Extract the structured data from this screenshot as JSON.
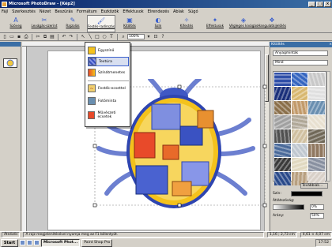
{
  "window": {
    "title": "Microsoft PhotoDraw - [Kép2]"
  },
  "menu": [
    "Fájl",
    "Szerkesztés",
    "Nézet",
    "Beszúrás",
    "Formátum",
    "Eszközök",
    "Effektusok",
    "Elrendezés",
    "Ablak",
    "Súgó"
  ],
  "big_toolbar": [
    {
      "label": "Szöveg",
      "icon": "text-icon"
    },
    {
      "label": "Levágás-szerint",
      "icon": "crop-icon"
    },
    {
      "label": "Rajzolás",
      "icon": "draw-icon"
    },
    {
      "label": "Festés-radírozás",
      "icon": "paint-icon"
    },
    {
      "label": "Kitöltés",
      "icon": "fill-icon"
    },
    {
      "label": "Szín",
      "icon": "color-icon"
    },
    {
      "label": "Kifestés",
      "icon": "touch-up-icon"
    },
    {
      "label": "Effektusok",
      "icon": "effects-icon"
    },
    {
      "label": "Végleges kivágás",
      "icon": "cutout-icon"
    },
    {
      "label": "Hangulatkijelölés",
      "icon": "designer-icon"
    }
  ],
  "zoom": "100%",
  "dropdown": {
    "items": [
      {
        "label": "Egyszínű",
        "icon": "solid-fill-icon",
        "selected": false
      },
      {
        "label": "Textúra",
        "icon": "texture-icon",
        "selected": true
      },
      {
        "label": "Színátmenetes",
        "icon": "gradient-icon",
        "selected": false
      },
      {
        "label": "Festék-ecsettel",
        "icon": "brush-icon",
        "selected": false
      },
      {
        "label": "Fotóminta",
        "icon": "photo-icon",
        "selected": false
      },
      {
        "label": "Művészeti ecsetek",
        "icon": "art-brush-icon",
        "selected": false
      }
    ]
  },
  "right_panel": {
    "title": "Kitöltés",
    "category": "Anyagminták",
    "subcategory": "Mind",
    "swatch_colors": [
      "#2f4fa8",
      "#3566c0",
      "#c8c8c8",
      "#1a2f7a",
      "#d8b870",
      "#e0e0e0",
      "#8a6f4a",
      "#c29a6a",
      "#6a8fb0",
      "#a0a0a0",
      "#b0a898",
      "#e8e0d0",
      "#505050",
      "#d0c0a0",
      "#706858",
      "#4a6a9a",
      "#c0c8d0",
      "#907860",
      "#3a3a3a",
      "#e0d8c0",
      "#8890a0",
      "#2a4a8a",
      "#b8a080",
      "#d8d0c8"
    ],
    "more_button": "Továbbiak...",
    "color_label": "Szín:",
    "transparency_label": "Átlátszóság:",
    "transparency_value": "0%",
    "width_label": "Arány:",
    "width_value": "50%"
  },
  "status": {
    "message": "A rajz megjelenítésével nyomja meg az F1 billentyűt.",
    "coords": "1,16 ; 2,73 cm",
    "size": "4,61 × 4,07 cm",
    "left_tab": "Átnézés"
  },
  "taskbar": {
    "start": "Start",
    "items": [
      {
        "label": "Microsoft Phot...",
        "pressed": true
      },
      {
        "label": "Paint Shop Pro",
        "pressed": false
      }
    ],
    "clock": "17:52"
  }
}
